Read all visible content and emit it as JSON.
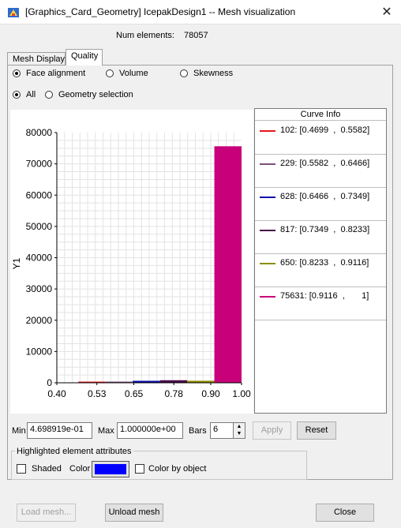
{
  "window": {
    "title": "[Graphics_Card_Geometry] IcepakDesign1 -- Mesh visualization",
    "close_glyph": "✕",
    "icon": "app-logo-icon"
  },
  "summary": {
    "num_elements_label": "Num elements:",
    "num_elements_value": "78057"
  },
  "tabs": [
    {
      "label": "Mesh Display",
      "active": false
    },
    {
      "label": "Quality",
      "active": true
    }
  ],
  "quality_metric": {
    "options": [
      "Face alignment",
      "Volume",
      "Skewness"
    ],
    "selected": "Face alignment"
  },
  "scope": {
    "options": [
      "All",
      "Geometry selection"
    ],
    "selected": "All"
  },
  "chart_data": {
    "type": "bar",
    "ylabel": "Y1",
    "xlabel": "",
    "xlim": [
      0.4,
      1.0
    ],
    "ylim": [
      0,
      80000
    ],
    "x_ticks": [
      "0.40",
      "0.53",
      "0.65",
      "0.78",
      "0.90",
      "1.00"
    ],
    "y_ticks": [
      "0",
      "10000",
      "20000",
      "30000",
      "40000",
      "50000",
      "60000",
      "70000",
      "80000"
    ],
    "grid": true,
    "legend_title": "Curve Info",
    "series": [
      {
        "name": "102: [0.4699  ,  0.5582]",
        "count": 102,
        "range": [
          0.4699,
          0.5582
        ],
        "color": "#e8141c"
      },
      {
        "name": "229: [0.5582  ,  0.6466]",
        "count": 229,
        "range": [
          0.5582,
          0.6466
        ],
        "color": "#7a4f7a"
      },
      {
        "name": "628: [0.6466  ,  0.7349]",
        "count": 628,
        "range": [
          0.6466,
          0.7349
        ],
        "color": "#0a0aa8"
      },
      {
        "name": "817: [0.7349  ,  0.8233]",
        "count": 817,
        "range": [
          0.7349,
          0.8233
        ],
        "color": "#4a0a4a"
      },
      {
        "name": "650: [0.8233  ,  0.9116]",
        "count": 650,
        "range": [
          0.8233,
          0.9116
        ],
        "color": "#8c8c00"
      },
      {
        "name": "75631: [0.9116  ,       1]",
        "count": 75631,
        "range": [
          0.9116,
          1.0
        ],
        "color": "#c8007a"
      }
    ]
  },
  "range_controls": {
    "min_label": "Min",
    "min_value": "4.698919e-01",
    "max_label": "Max",
    "max_value": "1.000000e+00",
    "bars_label": "Bars",
    "bars_value": "6",
    "apply_label": "Apply",
    "reset_label": "Reset"
  },
  "highlight": {
    "group_label": "Highlighted element attributes",
    "shaded_label": "Shaded",
    "shaded_checked": false,
    "color_label": "Color",
    "color_value": "#0000ff",
    "color_by_object_label": "Color by object",
    "color_by_object_checked": false
  },
  "footer": {
    "load_mesh_label": "Load mesh...",
    "unload_mesh_label": "Unload mesh",
    "close_label": "Close"
  }
}
